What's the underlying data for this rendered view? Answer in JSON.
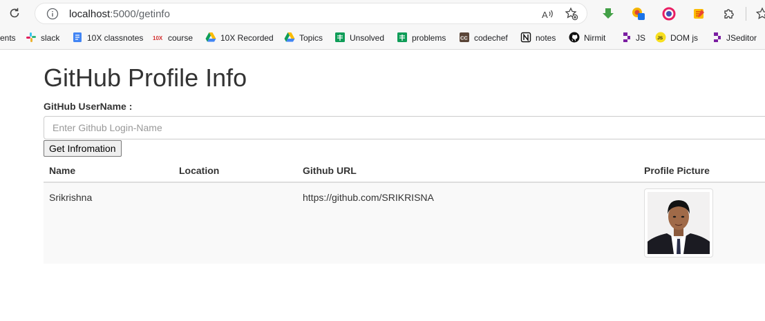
{
  "browser": {
    "url_host": "localhost",
    "url_path": ":5000/getinfo",
    "bookmarks": [
      {
        "label": "ents",
        "icon": "none"
      },
      {
        "label": "slack",
        "icon": "slack-icon"
      },
      {
        "label": "10X classnotes",
        "icon": "docs-icon"
      },
      {
        "label": "course",
        "icon": "10x-icon"
      },
      {
        "label": "10X Recorded",
        "icon": "drive-icon"
      },
      {
        "label": "Topics",
        "icon": "drive-icon"
      },
      {
        "label": "Unsolved",
        "icon": "sheets-icon"
      },
      {
        "label": "problems",
        "icon": "sheets-icon"
      },
      {
        "label": "codechef",
        "icon": "codechef-icon"
      },
      {
        "label": "notes",
        "icon": "notion-icon"
      },
      {
        "label": "Nirmit",
        "icon": "github-icon"
      },
      {
        "label": "JS",
        "icon": "replit-icon"
      },
      {
        "label": "DOM js",
        "icon": "js-icon"
      },
      {
        "label": "JSeditor",
        "icon": "replit-icon"
      }
    ]
  },
  "page": {
    "title": "GitHub Profile Info",
    "username_label": "GitHub UserName :",
    "username_placeholder": "Enter Github Login-Name",
    "username_value": "",
    "button_label": "Get Infromation"
  },
  "table": {
    "headers": [
      "Name",
      "Location",
      "Github URL",
      "Profile Picture"
    ],
    "rows": [
      {
        "name": "Srikrishna",
        "location": "",
        "url": "https://github.com/SRIKRISNA",
        "picture": "profile-photo"
      }
    ]
  },
  "colors": {
    "accent_blue": "#1a73e8",
    "table_stripe": "#f9f9f9",
    "table_border": "#dddddd"
  }
}
